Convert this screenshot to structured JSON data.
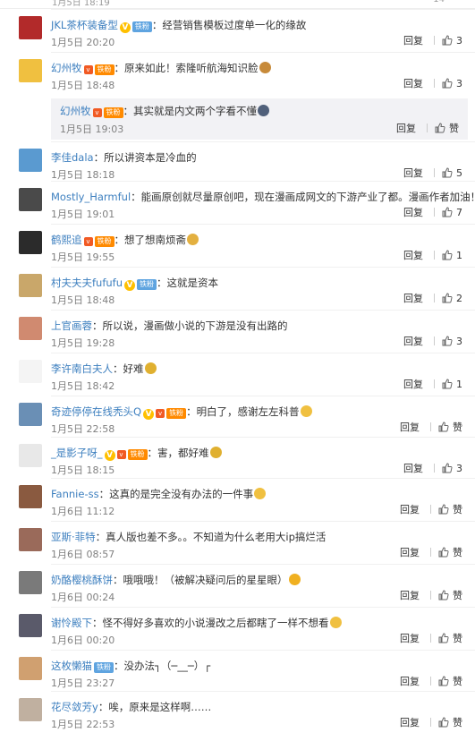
{
  "top_partial": {
    "time": "1月5日 18:19",
    "likes": "14"
  },
  "comments": [
    {
      "user": "JKL茶杯装备型",
      "badges": [
        "v",
        "fan"
      ],
      "badge_fan": "铁粉",
      "text": "经营销售模板过度单一化的缘故",
      "time": "1月5日 20:20",
      "reply": "回复",
      "likes": "3",
      "avatar_color": "#b22a2a",
      "emoji": ""
    },
    {
      "user": "幻州牧",
      "badges": [
        "vip",
        "gold"
      ],
      "badge_gold": "铁粉",
      "text": "原来如此！索隆听航海知识脸",
      "time": "1月5日 18:48",
      "reply": "回复",
      "likes": "3",
      "avatar_color": "#f0c040",
      "emoji": "#c78a3a"
    },
    {
      "user": "李佳dala",
      "badges": [],
      "text": "所以讲资本是冷血的",
      "time": "1月5日 18:18",
      "reply": "回复",
      "likes": "5",
      "avatar_color": "#5a9ad0",
      "emoji": ""
    },
    {
      "user": "Mostly_Harmful",
      "badges": [],
      "text": "能画原创就尽量原创吧，现在漫画成网文的下游产业了都。漫画作者加油！",
      "time": "1月5日 19:01",
      "reply": "回复",
      "likes": "7",
      "avatar_color": "#4a4a4a",
      "emoji": "#6b7080"
    },
    {
      "user": "鹤熙追",
      "badges": [
        "vip",
        "gold"
      ],
      "badge_gold": "铁粉",
      "text": "想了想南烦斋",
      "time": "1月5日 19:55",
      "reply": "回复",
      "likes": "1",
      "avatar_color": "#2b2b2b",
      "emoji": "#e3b040"
    },
    {
      "user": "村夫夫夫fufufu",
      "badges": [
        "v",
        "fan"
      ],
      "badge_fan": "铁粉",
      "text": "这就是资本",
      "time": "1月5日 18:48",
      "reply": "回复",
      "likes": "2",
      "avatar_color": "#c9a76a",
      "emoji": ""
    },
    {
      "user": "上官画蓉",
      "badges": [],
      "text": "所以说，漫画做小说的下游是没有出路的",
      "time": "1月5日 19:28",
      "reply": "回复",
      "likes": "3",
      "avatar_color": "#d08a70",
      "emoji": ""
    },
    {
      "user": "李许南白夫人",
      "badges": [],
      "text": "好难",
      "time": "1月5日 18:42",
      "reply": "回复",
      "likes": "1",
      "avatar_color": "#f4f4f4",
      "emoji": "#e0b030"
    },
    {
      "user": "奇迹停停在线秃头Q",
      "badges": [
        "v",
        "vip",
        "gold"
      ],
      "badge_gold": "铁粉",
      "text": "明白了，感谢左左科普",
      "time": "1月5日 22:58",
      "reply": "回复",
      "likes": "",
      "avatar_color": "#6a8fb5",
      "emoji": "#f0c040"
    },
    {
      "user": "_是影子呀_",
      "badges": [
        "v",
        "vip",
        "gold"
      ],
      "badge_gold": "铁粉",
      "text": "害，都好难",
      "time": "1月5日 18:15",
      "reply": "回复",
      "likes": "3",
      "avatar_color": "#e8e8e8",
      "emoji": "#e0b030"
    },
    {
      "user": "Fannie-ss",
      "badges": [],
      "text": "这真的是完全没有办法的一件事",
      "time": "1月6日 11:12",
      "reply": "回复",
      "likes": "",
      "avatar_color": "#8a5a40",
      "emoji": "#f0c040"
    },
    {
      "user": "亚斯·菲特",
      "badges": [],
      "text": "真人版也差不多。。不知道为什么老用大ip搞烂活",
      "time": "1月6日 08:57",
      "reply": "回复",
      "likes": "",
      "avatar_color": "#9a6a5a",
      "emoji": ""
    },
    {
      "user": "奶酪樱桃酥饼",
      "badges": [],
      "text": "哦哦哦！（被解决疑问后的星星眼）",
      "time": "1月6日 00:24",
      "reply": "回复",
      "likes": "",
      "avatar_color": "#7a7a7a",
      "emoji": "#f0b020"
    },
    {
      "user": "谢怜殿下",
      "badges": [],
      "text": "怪不得好多喜欢的小说漫改之后都瞎了一样不想看",
      "time": "1月6日 00:20",
      "reply": "回复",
      "likes": "",
      "avatar_color": "#5a5a6a",
      "emoji": "#f0c040"
    },
    {
      "user": "这枚懒猫",
      "badges": [
        "fan"
      ],
      "badge_fan": "铁粉",
      "text": "没办法┐（─__─）┌",
      "time": "1月5日 23:27",
      "reply": "回复",
      "likes": "",
      "avatar_color": "#d0a070",
      "emoji": ""
    },
    {
      "user": "花尽敛芳y",
      "badges": [],
      "text": "唉，原来是这样啊……",
      "time": "1月5日 22:53",
      "reply": "回复",
      "likes": "",
      "avatar_color": "#c0b0a0",
      "emoji": ""
    }
  ],
  "sub_reply": {
    "user": "幻州牧",
    "badge_gold": "铁粉",
    "text": "其实就是内文两个字看不懂",
    "time": "1月5日 19:03",
    "reply": "回复",
    "like_label": "赞"
  },
  "like_label": "赞",
  "colors": {
    "orange_name": "#eb7350",
    "blue_name": "#3d7fbf",
    "time_gray": "#808080"
  }
}
